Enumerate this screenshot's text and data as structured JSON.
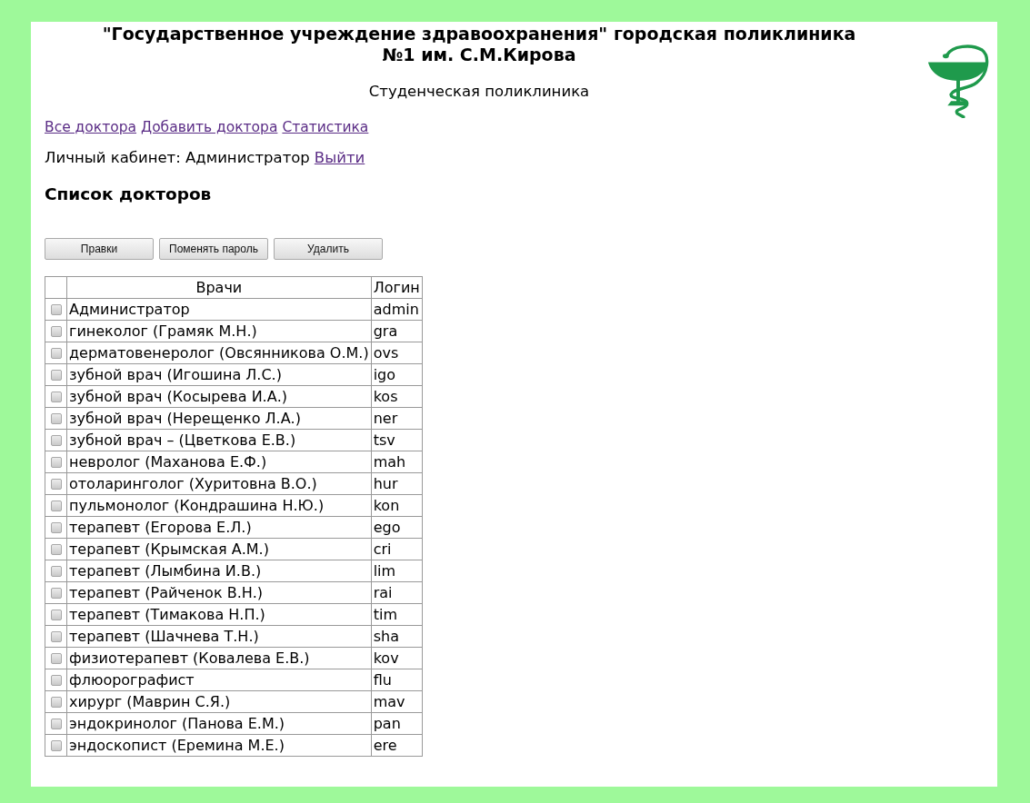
{
  "header": {
    "title_lines": [
      "\"Государственное учреждение здравоохранения\" городская поликлиника",
      "№1 им. С.М.Кирова"
    ],
    "subtitle": "Студенческая поликлиника"
  },
  "nav_links": [
    "Все доктора",
    "Добавить доктора",
    "Статистика"
  ],
  "account": {
    "label": "Личный кабинет: Администратор",
    "logout_link": "Выйти"
  },
  "heading": "Список докторов",
  "buttons": [
    "Правки",
    "Поменять пароль",
    "Удалить"
  ],
  "table": {
    "columns": [
      "Врачи",
      "Логин"
    ],
    "rows": [
      {
        "checked": false,
        "doctor": "Администратор",
        "login": "admin"
      },
      {
        "checked": false,
        "doctor": "гинеколог (Грамяк М.Н.)",
        "login": "gra"
      },
      {
        "checked": false,
        "doctor": "дерматовенеролог (Овсянникова О.М.)",
        "login": "ovs"
      },
      {
        "checked": false,
        "doctor": "зубной врач (Игошина Л.С.)",
        "login": "igo"
      },
      {
        "checked": false,
        "doctor": "зубной врач (Косырева И.А.)",
        "login": "kos"
      },
      {
        "checked": false,
        "doctor": "зубной врач (Нерещенко Л.А.)",
        "login": "ner"
      },
      {
        "checked": false,
        "doctor": "зубной врач – (Цветкова Е.В.)",
        "login": "tsv"
      },
      {
        "checked": false,
        "doctor": "невролог (Маханова Е.Ф.)",
        "login": "mah"
      },
      {
        "checked": false,
        "doctor": "отоларинголог (Хуритовна В.О.)",
        "login": "hur"
      },
      {
        "checked": false,
        "doctor": "пульмонолог (Кондрашина Н.Ю.)",
        "login": "kon"
      },
      {
        "checked": false,
        "doctor": "терапевт (Егорова Е.Л.)",
        "login": "ego"
      },
      {
        "checked": false,
        "doctor": "терапевт (Крымская А.М.)",
        "login": "cri"
      },
      {
        "checked": false,
        "doctor": "терапевт (Лымбина И.В.)",
        "login": "lim"
      },
      {
        "checked": false,
        "doctor": "терапевт (Райченок В.Н.)",
        "login": "rai"
      },
      {
        "checked": false,
        "doctor": "терапевт (Тимакова Н.П.)",
        "login": "tim"
      },
      {
        "checked": false,
        "doctor": "терапевт (Шачнева Т.Н.)",
        "login": "sha"
      },
      {
        "checked": false,
        "doctor": "физиотерапевт (Ковалева Е.В.)",
        "login": "kov"
      },
      {
        "checked": false,
        "doctor": "флюорографист",
        "login": "flu"
      },
      {
        "checked": false,
        "doctor": "хирург (Маврин С.Я.)",
        "login": "mav"
      },
      {
        "checked": false,
        "doctor": "эндокринолог (Панова Е.М.)",
        "login": "pan"
      },
      {
        "checked": false,
        "doctor": "эндоскопист (Еремина М.Е.)",
        "login": "ere"
      }
    ]
  }
}
